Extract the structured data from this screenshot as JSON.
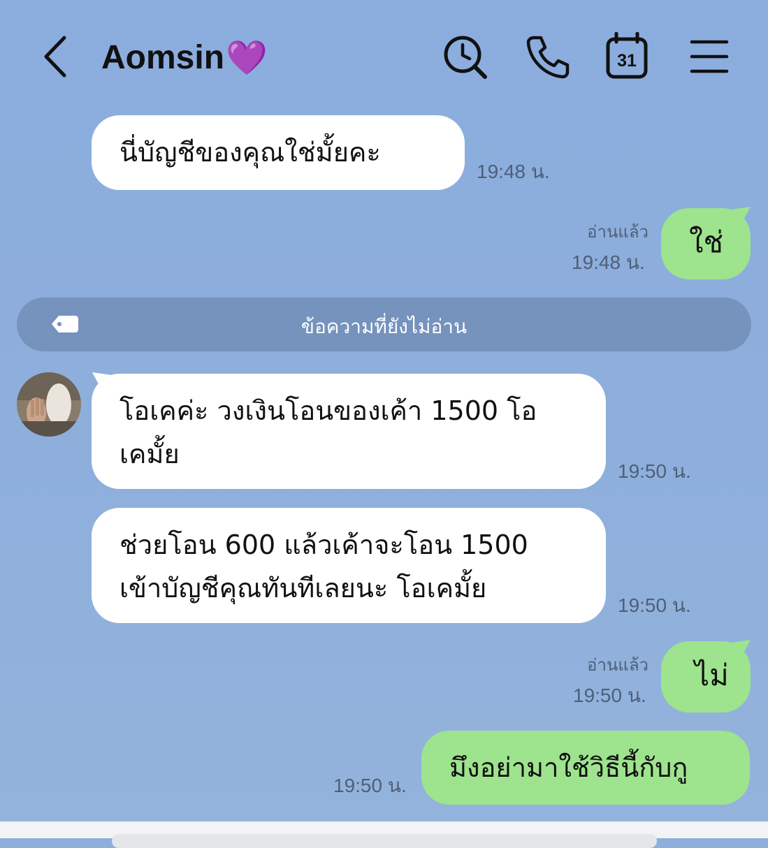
{
  "header": {
    "title": "Aomsin",
    "title_emoji": "💜",
    "calendar_day": "31",
    "colors": {
      "background": "#8eaedb",
      "text": "#111111"
    }
  },
  "messages": [
    {
      "side": "them",
      "text_lines": [
        "นี่บัญชีของคุณใช่มั้ยคะ"
      ],
      "time": "19:48 น."
    },
    {
      "side": "me",
      "text_lines": [
        "ใช่"
      ],
      "read": "อ่านแล้ว",
      "time": "19:48 น."
    },
    {
      "side": "them",
      "text_lines": [
        "โอเคค่ะ วงเงินโอนของเค้า 1500 โอ",
        "เคมั้ย"
      ],
      "time": "19:50 น."
    },
    {
      "side": "them",
      "text_lines": [
        "ช่วยโอน 600 แล้วเค้าจะโอน 1500",
        "เข้าบัญชีคุณทันทีเลยนะ โอเคมั้ย"
      ],
      "time": "19:50 น."
    },
    {
      "side": "me",
      "text_lines": [
        "ไม่"
      ],
      "read": "อ่านแล้ว",
      "time": "19:50 น."
    },
    {
      "side": "me",
      "text_lines": [
        "มึงอย่ามาใช้วิธีนี้กับกู"
      ],
      "time": "19:50 น."
    }
  ],
  "unread_divider": {
    "label": "ข้อความที่ยังไม่อ่าน",
    "icon": "tag-icon"
  },
  "icons": [
    "back-arrow-icon",
    "search-clock-icon",
    "phone-icon",
    "calendar-icon",
    "hamburger-menu-icon",
    "avatar"
  ],
  "colors": {
    "incoming_bubble": "#ffffff",
    "outgoing_bubble": "#9ee38d",
    "divider": "#7593bc",
    "timestamp": "#4e5f78"
  }
}
